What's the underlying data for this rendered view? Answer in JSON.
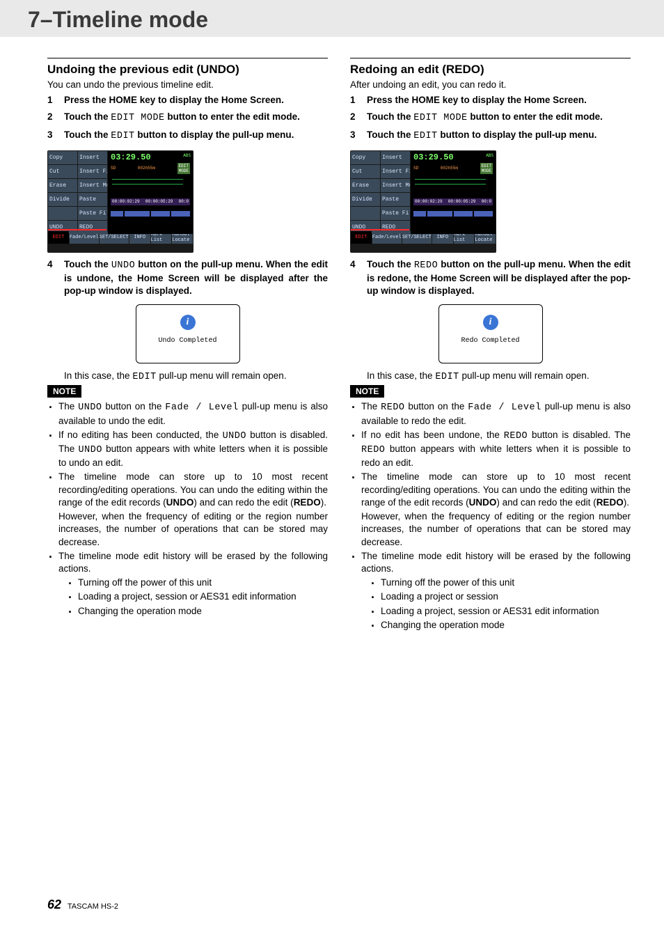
{
  "header": {
    "title": "7–Timeline mode"
  },
  "footer": {
    "page": "62",
    "product": "TASCAM HS-2"
  },
  "device": {
    "menu": [
      "Copy",
      "Insert",
      "Cut",
      "Insert File",
      "Erase",
      "Insert Mute",
      "Divide",
      "Paste",
      "",
      "Paste File",
      "UNDO",
      "REDO"
    ],
    "timecode": "03:29.50",
    "tc_suffix": "ABS",
    "status_sd": "SD",
    "status_time": "002h55m",
    "status_badge_top": "EDIT",
    "status_badge_bot": "MODE",
    "stripe_left": "00:00:02:29",
    "stripe_mid": "00:00:05:29",
    "stripe_right": "00:0",
    "bottom": [
      "Fade/Level",
      "SET/SELECT",
      "INFO",
      "Mark List",
      "Manual Locate"
    ],
    "bottom_edit": "EDIT"
  },
  "left": {
    "section_title": "Undoing the previous edit (UNDO)",
    "intro": "You can undo the previous timeline edit.",
    "steps": [
      {
        "t": "Press the HOME key to display the Home Screen."
      },
      {
        "pre": "Touch the ",
        "mono": "EDIT MODE",
        "post": " button to enter the edit mode."
      },
      {
        "pre": "Touch the ",
        "mono": "EDIT",
        "post": " button to display the pull-up menu."
      },
      {
        "pre": "Touch the ",
        "mono": "UNDO",
        "post": " button on the pull-up menu. When the edit is undone, the Home Screen will be displayed after the pop-up window is displayed."
      }
    ],
    "popup_msg": "Undo Completed",
    "after_popup_pre": "In this case, the ",
    "after_popup_mono": "EDIT",
    "after_popup_post": " pull-up menu will remain open.",
    "note_label": "NOTE",
    "notes": {
      "n1_pre": "The ",
      "n1_m1": "UNDO",
      "n1_mid": " button on the ",
      "n1_m2": "Fade / Level",
      "n1_post": " pull-up menu is also available to undo the edit.",
      "n2_pre": "If no editing has been conducted, the ",
      "n2_m1": "UNDO",
      "n2_mid": " button is disabled. The ",
      "n2_m2": "UNDO",
      "n2_post": " button appears with white letters when it is possible to undo an edit.",
      "n3_a": "The timeline mode can store up to 10 most recent recording/editing operations. You can undo the editing within the range of the edit records (",
      "n3_b": "UNDO",
      "n3_c": ") and can redo the edit (",
      "n3_d": "REDO",
      "n3_e": ").",
      "n3_f": "However, when the frequency of editing or the region number increases, the number of operations that can be stored may decrease.",
      "n4": "The timeline mode edit history will be erased by the following actions.",
      "sub": [
        "Turning off the power of this unit",
        "Loading a project, session or AES31 edit information",
        "Changing the operation mode"
      ]
    }
  },
  "right": {
    "section_title": "Redoing an edit (REDO)",
    "intro": "After undoing an edit, you can redo it.",
    "steps": [
      {
        "t": "Press the HOME key to display the Home Screen."
      },
      {
        "pre": "Touch the ",
        "mono": "EDIT MODE",
        "post": " button to enter the edit mode."
      },
      {
        "pre": "Touch the ",
        "mono": "EDIT",
        "post": " button to display the pull-up menu."
      },
      {
        "pre": "Touch the ",
        "mono": "REDO",
        "post": " button on the pull-up menu. When the edit is redone, the Home Screen will be displayed after the pop-up window is displayed."
      }
    ],
    "popup_msg": "Redo Completed",
    "after_popup_pre": "In this case, the ",
    "after_popup_mono": "EDIT",
    "after_popup_post": " pull-up menu will remain open.",
    "note_label": "NOTE",
    "notes": {
      "n1_pre": "The ",
      "n1_m1": "REDO",
      "n1_mid": " button on the ",
      "n1_m2": "Fade / Level",
      "n1_post": " pull-up menu is also available to redo the edit.",
      "n2_pre": "If no edit has been undone, the ",
      "n2_m1": "REDO",
      "n2_mid": " button is disabled. The ",
      "n2_m2": "REDO",
      "n2_post": " button appears with white letters when it is possible to redo an edit.",
      "n3_a": "The timeline mode can store up to 10 most recent recording/editing operations. You can undo the editing within the range of the edit records (",
      "n3_b": "UNDO",
      "n3_c": ") and can redo the edit (",
      "n3_d": "REDO",
      "n3_e": ").",
      "n3_f": "However, when the frequency of editing or the region number increases, the number of operations that can be stored may decrease.",
      "n4": "The timeline mode edit history will be erased by the following actions.",
      "sub": [
        "Turning off the power of this unit",
        "Loading a project or session",
        "Loading a project, session or AES31 edit information",
        "Changing the operation mode"
      ]
    }
  }
}
